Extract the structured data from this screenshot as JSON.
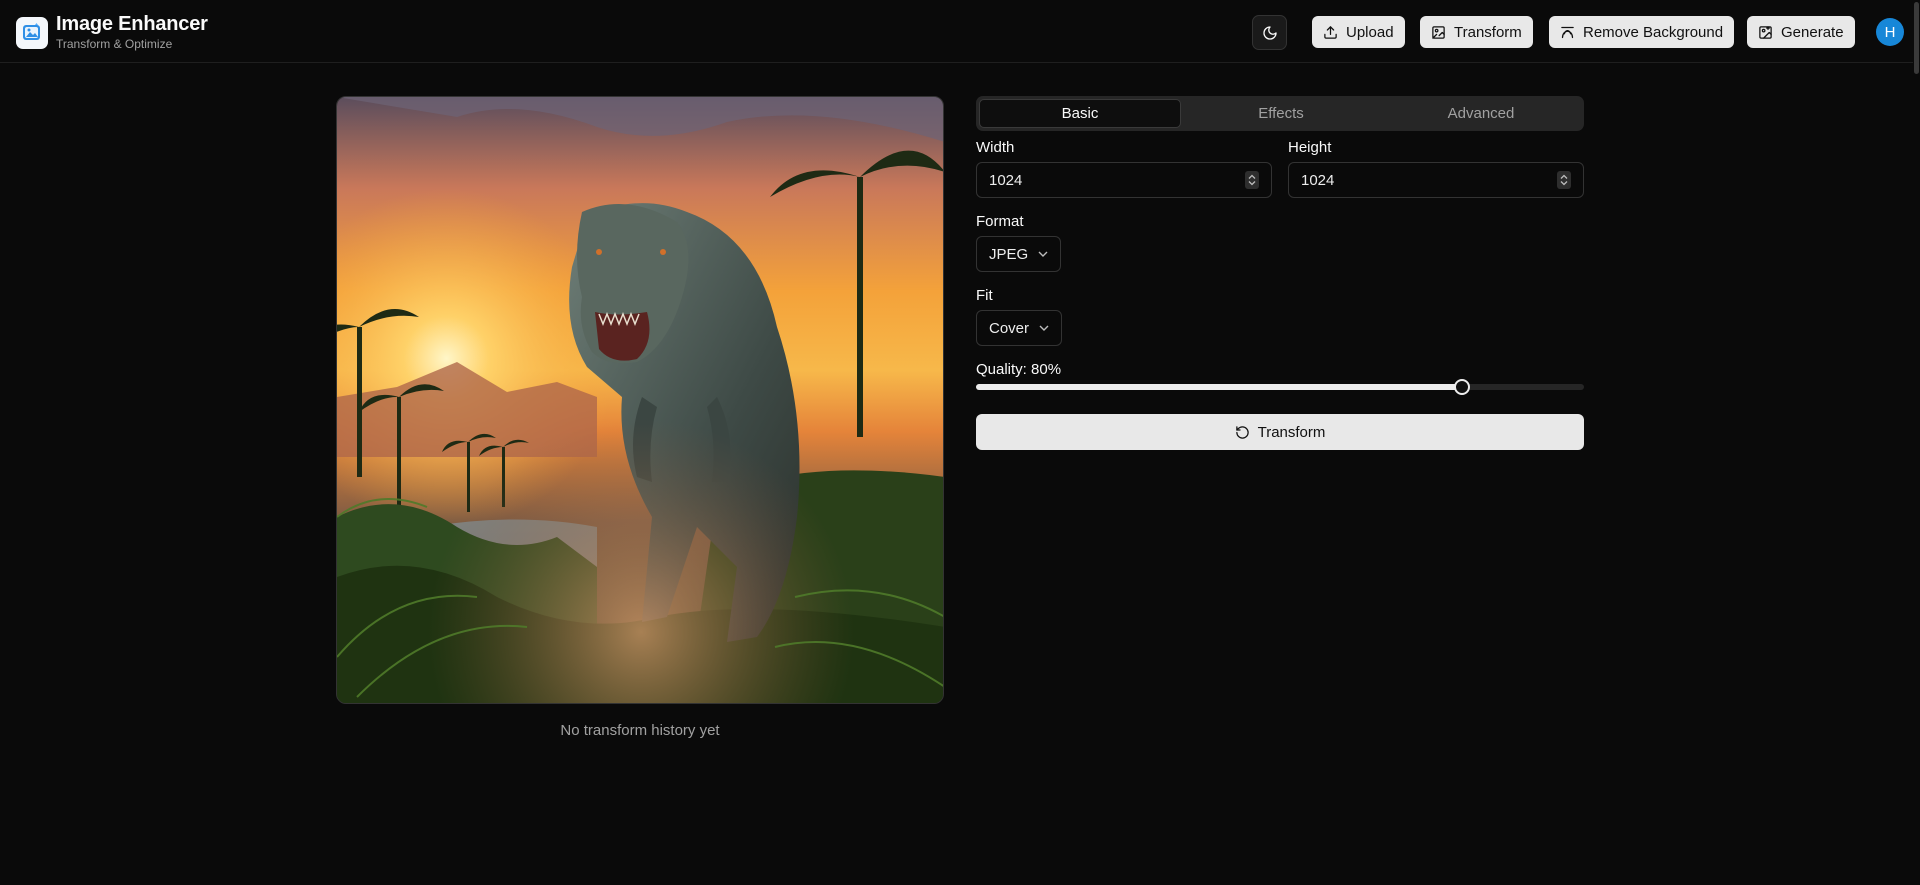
{
  "app": {
    "title": "Image Enhancer",
    "subtitle": "Transform & Optimize"
  },
  "header": {
    "theme_icon": "moon-icon",
    "buttons": [
      {
        "label": "Upload",
        "icon": "upload-icon"
      },
      {
        "label": "Transform",
        "icon": "image-transform-icon"
      },
      {
        "label": "Remove Background",
        "icon": "remove-bg-icon"
      },
      {
        "label": "Generate",
        "icon": "image-generate-icon"
      }
    ],
    "avatar_initial": "H"
  },
  "preview": {
    "history_text": "No transform history yet"
  },
  "tabs": [
    {
      "label": "Basic",
      "active": true
    },
    {
      "label": "Effects",
      "active": false
    },
    {
      "label": "Advanced",
      "active": false
    }
  ],
  "form": {
    "width_label": "Width",
    "width_value": "1024",
    "height_label": "Height",
    "height_value": "1024",
    "format_label": "Format",
    "format_value": "JPEG",
    "fit_label": "Fit",
    "fit_value": "Cover",
    "quality_label": "Quality: 80%",
    "quality_value": 80,
    "submit_label": "Transform"
  },
  "colors": {
    "background": "#0a0a0a",
    "button_bg": "#e8e8e8",
    "avatar": "#1787d8"
  }
}
